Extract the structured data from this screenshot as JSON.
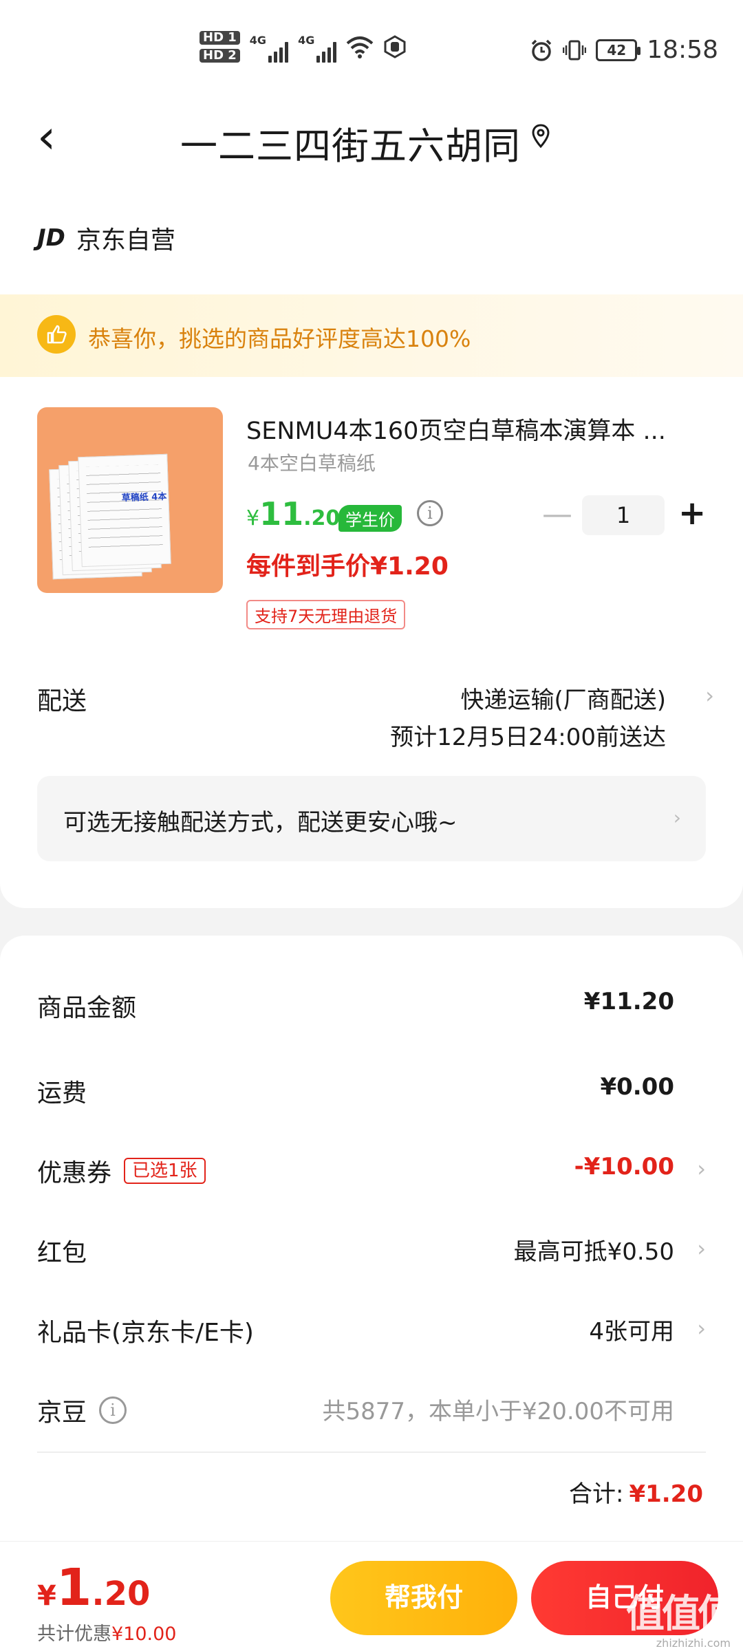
{
  "status": {
    "hd1": "HD 1",
    "hd2": "HD 2",
    "net1": "4G",
    "net2": "4G",
    "battery": "42",
    "time": "18:58"
  },
  "header": {
    "back_glyph": "‹",
    "address": "一二三四街五六胡同"
  },
  "store": {
    "logo": "JD",
    "name": "京东自营"
  },
  "praise": {
    "text": "恭喜你，挑选的商品好评度高达100%"
  },
  "product": {
    "image_tag": "草稿纸 4本",
    "title": "SENMU4本160页空白草稿本演算本 ...",
    "spec": "4本空白草稿纸",
    "price_yen": "¥",
    "price_int": "11",
    "price_dec": ".20",
    "student_badge": "学生价",
    "qty": "1",
    "per_item_price": "每件到手价¥1.20",
    "return_policy": "支持7天无理由退货"
  },
  "shipping": {
    "label": "配送",
    "method": "快递运输(厂商配送)",
    "eta": "预计12月5日24:00前送达",
    "contactless": "可选无接触配送方式，配送更安心哦~"
  },
  "summary": {
    "goods_label": "商品金额",
    "goods_value": "¥11.20",
    "freight_label": "运费",
    "freight_value": "¥0.00",
    "coupon_label": "优惠券",
    "coupon_badge": "已选1张",
    "coupon_value": "-¥10.00",
    "redpacket_label": "红包",
    "redpacket_value": "最高可抵¥0.50",
    "giftcard_label": "礼品卡(京东卡/E卡)",
    "giftcard_value": "4张可用",
    "bean_label": "京豆",
    "bean_value": "共5877，本单小于¥20.00不可用",
    "total_label": "合计:",
    "total_value": "¥1.20"
  },
  "bottom": {
    "price_yen": "¥",
    "price_int": "1",
    "price_dec": ".20",
    "saved_label": "共计优惠",
    "saved_value": "¥10.00",
    "help_pay": "帮我付",
    "self_pay": "自己付",
    "watermark": "值值值",
    "watermark_sub": "zhizhizhi.com"
  },
  "colors": {
    "accent_red": "#e2231a",
    "student_green": "#27b83a",
    "praise_orange": "#d9820e",
    "help_button": "#ffb10a",
    "self_button": "#f0232b"
  },
  "icons": [
    "back-chevron-icon",
    "location-pin-icon",
    "thumbs-up-icon",
    "info-icon",
    "minus-icon",
    "plus-icon",
    "chevron-right-icon",
    "alarm-icon",
    "vibrate-icon",
    "wifi-icon",
    "signal-icon"
  ]
}
